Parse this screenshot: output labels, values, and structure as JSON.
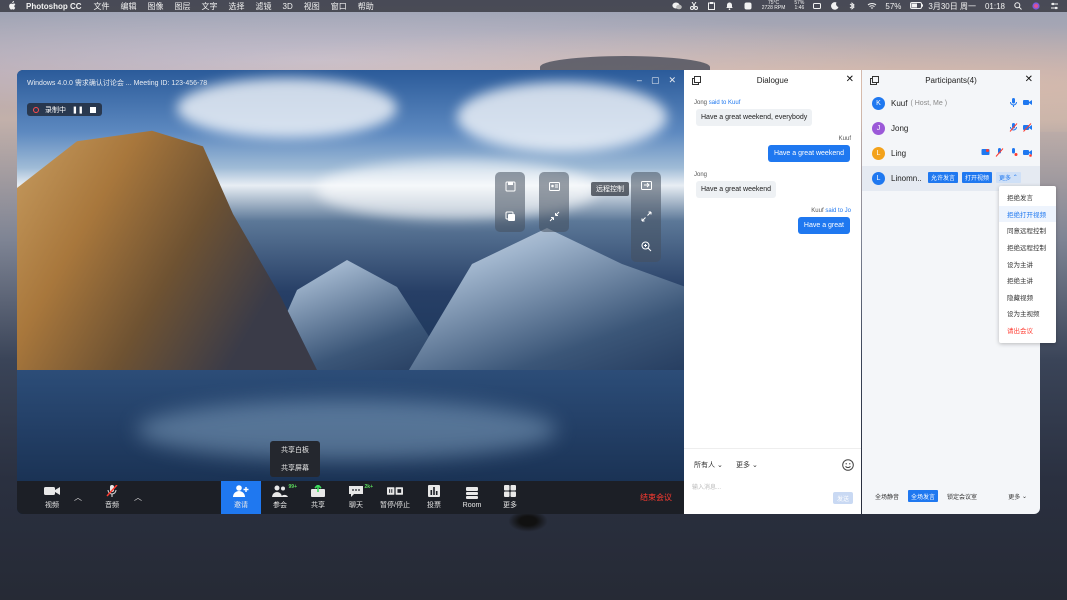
{
  "menubar": {
    "app_name": "Photoshop CC",
    "items": [
      "文件",
      "编辑",
      "图像",
      "图层",
      "文字",
      "选择",
      "滤镜",
      "3D",
      "视图",
      "窗口",
      "帮助"
    ],
    "cpu_temp": "75°C",
    "fan_rpm": "2728 RPM",
    "cpu_usage": "57%",
    "cpu_time": "1:46",
    "battery_pct": "57%",
    "date": "3月30日 周一",
    "time": "01:18"
  },
  "video": {
    "window_title": "Windows 4.0.0 需求确认讨论会 ...  Meeting ID: 123-456-78",
    "recording_label": "录制中",
    "remote_control_label": "远程控制"
  },
  "share_popup": {
    "items": [
      "共享白板",
      "共享屏幕"
    ]
  },
  "toolbar": {
    "video_label": "视频",
    "audio_label": "音频",
    "invite_label": "邀请",
    "participants_label": "参会",
    "participants_badge": "99+",
    "share_label": "共享",
    "chat_label": "聊天",
    "chat_badge": "2k+",
    "pause_label": "暂停/停止",
    "vote_label": "投票",
    "room_label": "Room",
    "more_label": "更多",
    "end_label": "结束会议"
  },
  "dialogue": {
    "title": "Dialogue",
    "messages": [
      {
        "sender": "Jong",
        "said_to": "said to Kuuf",
        "text": "Have a great weekend, everybody",
        "direction": "in"
      },
      {
        "sender": "Kuuf",
        "said_to": "",
        "text": "Have a great weekend",
        "direction": "out"
      },
      {
        "sender": "Jong",
        "said_to": "",
        "text": "Have a great weekend",
        "direction": "in"
      },
      {
        "sender": "Kuuf",
        "said_to": "said to Jo",
        "text": "Have a great",
        "direction": "out"
      }
    ],
    "recipient_select": "所有人",
    "more_select": "更多",
    "input_placeholder": "输入消息...",
    "send_label": "发送"
  },
  "participants": {
    "title": "Participants(4)",
    "list": [
      {
        "initial": "K",
        "name": "Kuuf",
        "sub": "( Host, Me )",
        "color": "#1f78f0"
      },
      {
        "initial": "J",
        "name": "Jong",
        "sub": "",
        "color": "#9b59d8"
      },
      {
        "initial": "L",
        "name": "Ling",
        "sub": "",
        "color": "#f3a21b"
      },
      {
        "initial": "L",
        "name": "Linomn..",
        "sub": "",
        "color": "#1f78f0"
      }
    ],
    "row_actions": {
      "allow_speak": "允许发言",
      "open_video": "打开视频",
      "more": "更多"
    },
    "footer": {
      "mute_all": "全场静音",
      "all_speak": "全场发言",
      "lock_room": "锁定会议室",
      "more": "更多"
    }
  },
  "context_menu": {
    "items": [
      "拒绝发言",
      "拒绝打开视频",
      "同意远程控制",
      "拒绝远程控制",
      "设为主讲",
      "拒绝主讲",
      "隐藏视频",
      "设为主视频",
      "请出会议"
    ]
  },
  "colors": {
    "accent": "#1f78f0",
    "danger": "#ff3b30",
    "toolbar_bg": "#1c1f26"
  }
}
